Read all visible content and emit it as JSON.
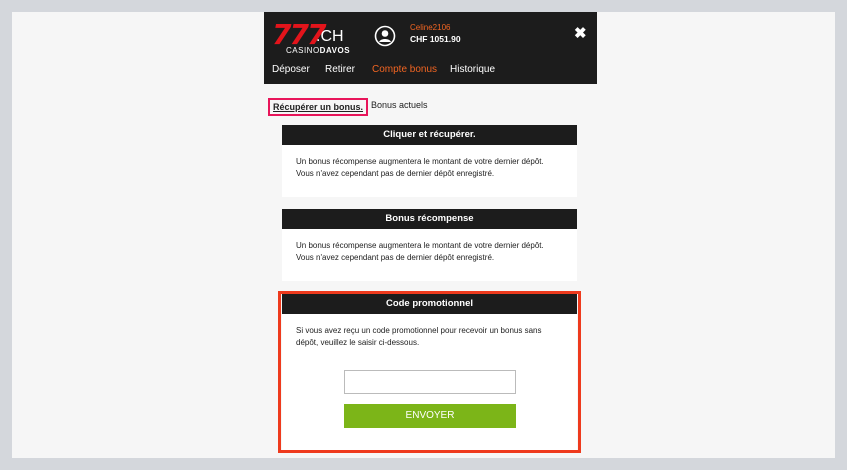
{
  "logo": {
    "number": "777",
    "domain": ".CH",
    "sub_prefix": "CASINO",
    "sub_brand": "DAVOS"
  },
  "user": {
    "name": "Celine2106",
    "balance": "CHF 1051.90"
  },
  "nav": {
    "items": [
      {
        "label": "Déposer"
      },
      {
        "label": "Retirer"
      },
      {
        "label": "Compte bonus",
        "active": true
      },
      {
        "label": "Historique"
      }
    ]
  },
  "subtabs": {
    "items": [
      {
        "label": "Récupérer un bonus.",
        "active": true
      },
      {
        "label": "Bonus actuels"
      }
    ]
  },
  "cards": {
    "click": {
      "title": "Cliquer et récupérer.",
      "text": "Un bonus récompense augmentera le montant de votre dernier dépôt. Vous n'avez cependant pas de dernier dépôt enregistré."
    },
    "reward": {
      "title": "Bonus récompense",
      "text": "Un bonus récompense augmentera le montant de votre dernier dépôt. Vous n'avez cependant pas de dernier dépôt enregistré."
    },
    "promo": {
      "title": "Code promotionnel",
      "text": "Si vous avez reçu un code promotionnel pour recevoir un bonus sans dépôt, veuillez le saisir ci-dessous.",
      "input_value": "",
      "button": "ENVOYER"
    }
  },
  "colors": {
    "header_bg": "#1c1c1c",
    "accent_orange": "#f26522",
    "logo_red": "#e3141b",
    "button_green": "#7cb518",
    "highlight_red": "#ee3a1d",
    "highlight_pink": "#e8155a"
  },
  "icons": {
    "avatar": "user-circle-icon",
    "close": "close-icon"
  }
}
